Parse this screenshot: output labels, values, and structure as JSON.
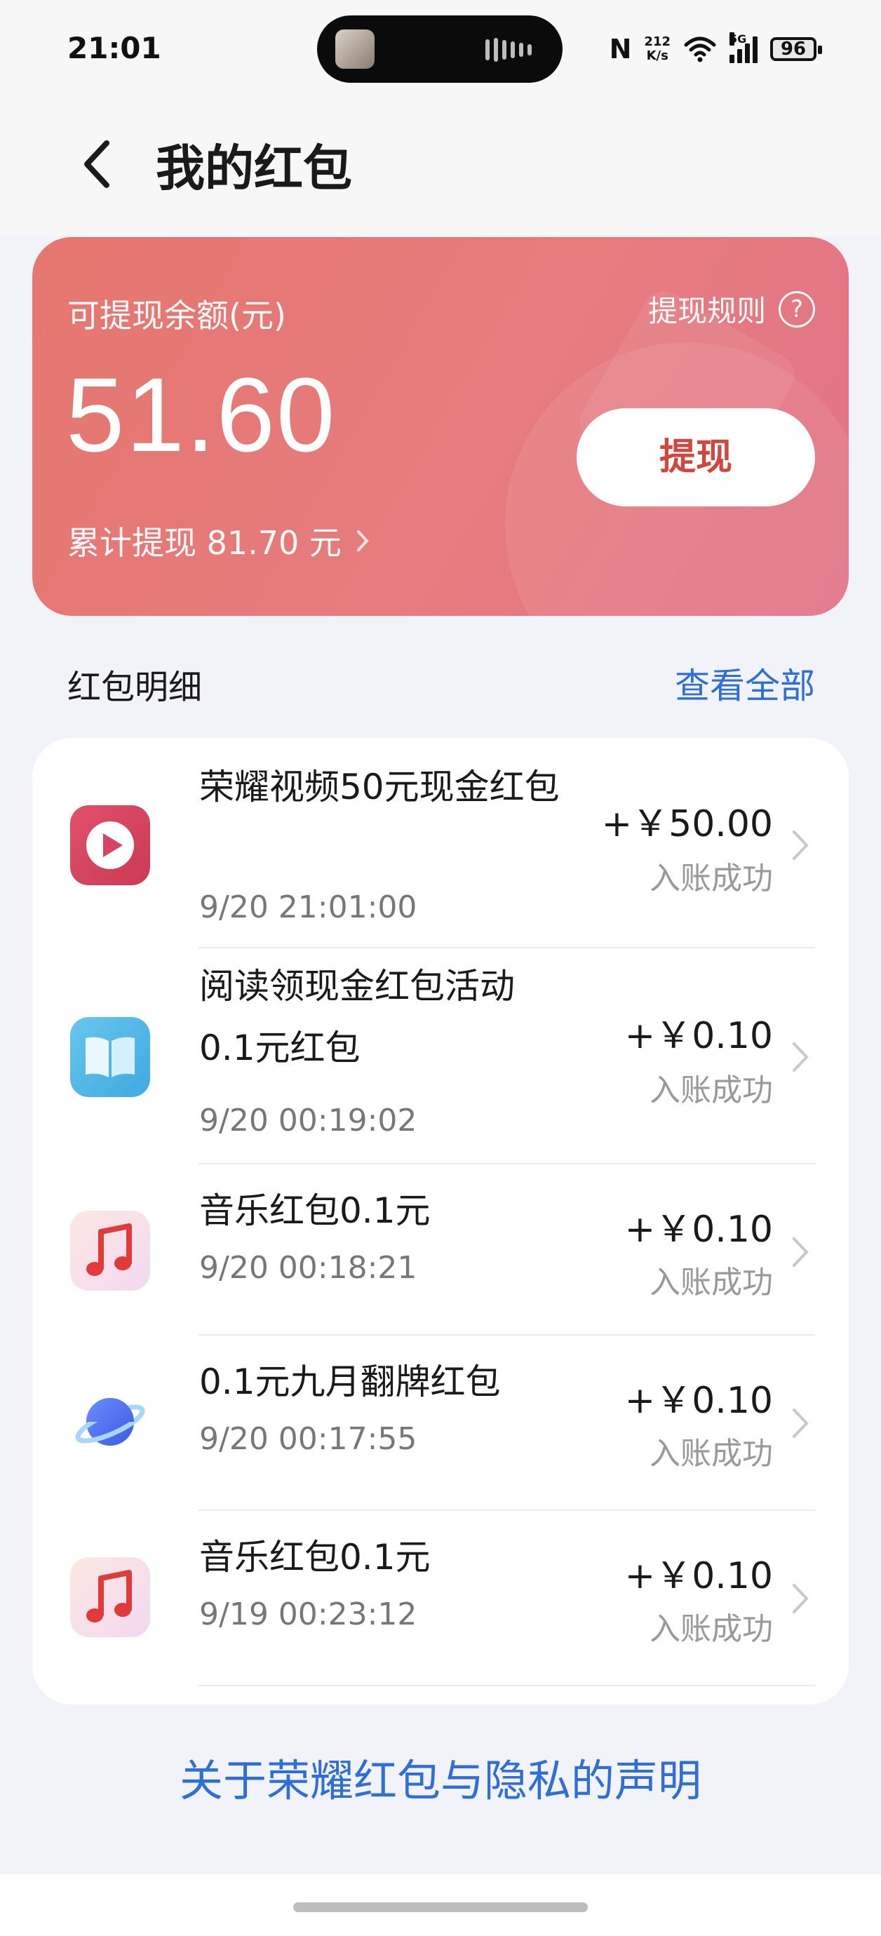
{
  "status_bar": {
    "time": "21:01",
    "network_speed_value": "212",
    "network_speed_unit": "K/s",
    "signal_label": "5G",
    "battery": "96"
  },
  "header": {
    "title": "我的红包"
  },
  "balance": {
    "label": "可提现余额(元)",
    "rules_label": "提现规则",
    "amount": "51.60",
    "withdraw_label": "提现",
    "total_label": "累计提现 81.70 元"
  },
  "details": {
    "section_title": "红包明细",
    "view_all_label": "查看全部",
    "items": [
      {
        "icon": "video-app-icon",
        "title": "荣耀视频50元现金红包",
        "time": "9/20 21:01:00",
        "amount": "+￥50.00",
        "status": "入账成功"
      },
      {
        "icon": "reading-app-icon",
        "title": "阅读领现金红包活动0.1元红包",
        "time": "9/20 00:19:02",
        "amount": "+￥0.10",
        "status": "入账成功"
      },
      {
        "icon": "music-app-icon",
        "title": "音乐红包0.1元",
        "time": "9/20 00:18:21",
        "amount": "+￥0.10",
        "status": "入账成功"
      },
      {
        "icon": "planet-app-icon",
        "title": "0.1元九月翻牌红包",
        "time": "9/20 00:17:55",
        "amount": "+￥0.10",
        "status": "入账成功"
      },
      {
        "icon": "music-app-icon",
        "title": "音乐红包0.1元",
        "time": "9/19 00:23:12",
        "amount": "+￥0.10",
        "status": "入账成功"
      }
    ]
  },
  "footer": {
    "privacy_link": "关于荣耀红包与隐私的声明"
  },
  "colors": {
    "accent_blue": "#2f6ed8",
    "card_red": "#e6766f",
    "withdraw_text": "#d2463e"
  }
}
